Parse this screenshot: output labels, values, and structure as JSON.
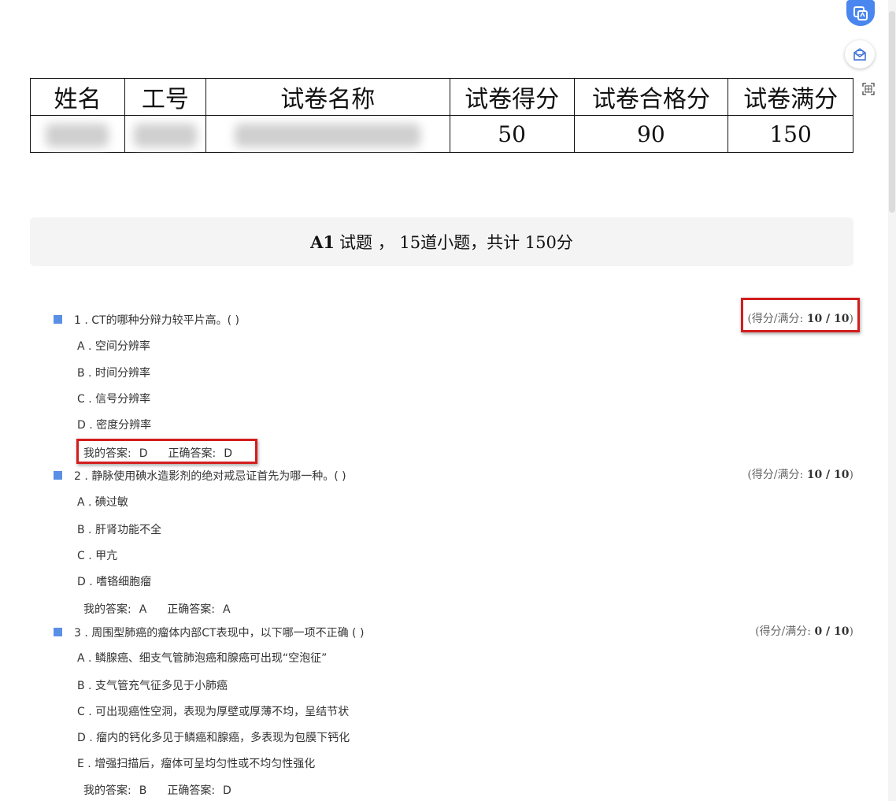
{
  "table": {
    "headers": [
      "姓名",
      "工号",
      "试卷名称",
      "试卷得分",
      "试卷合格分",
      "试卷满分"
    ],
    "values": {
      "score": "50",
      "pass_score": "90",
      "full_score": "150"
    }
  },
  "section": {
    "title": "A1",
    "desc": "试题 ， 15道小题，共计 150分"
  },
  "labels": {
    "score_prefix": "(得分/满分: ",
    "score_suffix": ")",
    "my_answer": "我的答案:",
    "correct_answer": "正确答案:"
  },
  "questions": [
    {
      "title": "1 . CT的哪种分辩力较平片高。( )",
      "score": "10 / 10",
      "options": [
        "A . 空间分辨率",
        "B . 时间分辨率",
        "C . 信号分辨率",
        "D . 密度分辨率"
      ],
      "my_answer": "D",
      "correct_answer": "D"
    },
    {
      "title": "2 . 静脉使用碘水造影剂的绝对戒忌证首先为哪一种。( )",
      "score": "10 / 10",
      "options": [
        "A . 碘过敏",
        "B . 肝肾功能不全",
        "C . 甲亢",
        "D . 嗜铬细胞瘤"
      ],
      "my_answer": "A",
      "correct_answer": "A"
    },
    {
      "title": "3 . 周围型肺癌的瘤体内部CT表现中，以下哪一项不正确 ( )",
      "score": "0 / 10",
      "options": [
        "A . 鳞腺癌、细支气管肺泡癌和腺癌可出现“空泡征”",
        "B . 支气管充气征多见于小肺癌",
        "C . 可出现癌性空洞，表现为厚壁或厚薄不均，呈结节状",
        "D . 瘤内的钙化多见于鳞癌和腺癌，多表现为包膜下钙化",
        "E . 增强扫描后，瘤体可呈均匀性或不均匀性强化"
      ],
      "my_answer": "B",
      "correct_answer": "D"
    }
  ],
  "colors": {
    "accent": "#5b8fe6",
    "highlight": "#d31d1d",
    "fab": "#4a86f0"
  },
  "icons": {
    "fab_primary": "image-translate-icon",
    "fab_mail": "mail-icon",
    "fab_scan": "scan-icon"
  }
}
